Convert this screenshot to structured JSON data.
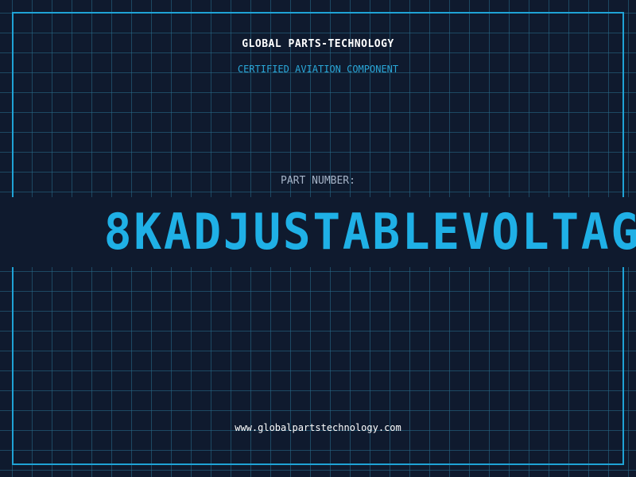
{
  "header": {
    "company": "GLOBAL PARTS-TECHNOLOGY",
    "subtitle": "CERTIFIED AVIATION COMPONENT"
  },
  "part": {
    "label": "PART NUMBER:",
    "number": "8KADJUSTABLEVOLTAG"
  },
  "footer": {
    "url": "www.globalpartstechnology.com"
  },
  "colors": {
    "background": "#0f1a2e",
    "accent": "#1fa3d6",
    "grid": "#286e8c",
    "text": "#ffffff",
    "muted": "#a6b4c8"
  }
}
